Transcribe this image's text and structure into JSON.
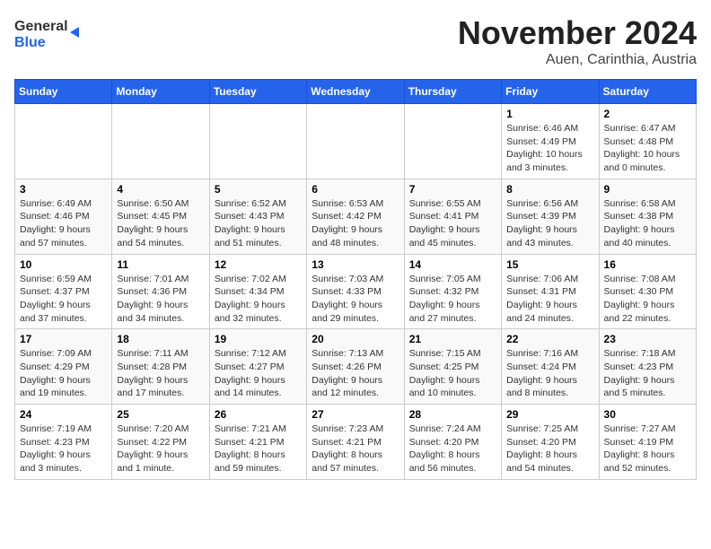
{
  "header": {
    "logo_line1": "General",
    "logo_line2": "Blue",
    "month_title": "November 2024",
    "location": "Auen, Carinthia, Austria"
  },
  "days_of_week": [
    "Sunday",
    "Monday",
    "Tuesday",
    "Wednesday",
    "Thursday",
    "Friday",
    "Saturday"
  ],
  "weeks": [
    [
      {
        "day": "",
        "info": ""
      },
      {
        "day": "",
        "info": ""
      },
      {
        "day": "",
        "info": ""
      },
      {
        "day": "",
        "info": ""
      },
      {
        "day": "",
        "info": ""
      },
      {
        "day": "1",
        "info": "Sunrise: 6:46 AM\nSunset: 4:49 PM\nDaylight: 10 hours and 3 minutes."
      },
      {
        "day": "2",
        "info": "Sunrise: 6:47 AM\nSunset: 4:48 PM\nDaylight: 10 hours and 0 minutes."
      }
    ],
    [
      {
        "day": "3",
        "info": "Sunrise: 6:49 AM\nSunset: 4:46 PM\nDaylight: 9 hours and 57 minutes."
      },
      {
        "day": "4",
        "info": "Sunrise: 6:50 AM\nSunset: 4:45 PM\nDaylight: 9 hours and 54 minutes."
      },
      {
        "day": "5",
        "info": "Sunrise: 6:52 AM\nSunset: 4:43 PM\nDaylight: 9 hours and 51 minutes."
      },
      {
        "day": "6",
        "info": "Sunrise: 6:53 AM\nSunset: 4:42 PM\nDaylight: 9 hours and 48 minutes."
      },
      {
        "day": "7",
        "info": "Sunrise: 6:55 AM\nSunset: 4:41 PM\nDaylight: 9 hours and 45 minutes."
      },
      {
        "day": "8",
        "info": "Sunrise: 6:56 AM\nSunset: 4:39 PM\nDaylight: 9 hours and 43 minutes."
      },
      {
        "day": "9",
        "info": "Sunrise: 6:58 AM\nSunset: 4:38 PM\nDaylight: 9 hours and 40 minutes."
      }
    ],
    [
      {
        "day": "10",
        "info": "Sunrise: 6:59 AM\nSunset: 4:37 PM\nDaylight: 9 hours and 37 minutes."
      },
      {
        "day": "11",
        "info": "Sunrise: 7:01 AM\nSunset: 4:36 PM\nDaylight: 9 hours and 34 minutes."
      },
      {
        "day": "12",
        "info": "Sunrise: 7:02 AM\nSunset: 4:34 PM\nDaylight: 9 hours and 32 minutes."
      },
      {
        "day": "13",
        "info": "Sunrise: 7:03 AM\nSunset: 4:33 PM\nDaylight: 9 hours and 29 minutes."
      },
      {
        "day": "14",
        "info": "Sunrise: 7:05 AM\nSunset: 4:32 PM\nDaylight: 9 hours and 27 minutes."
      },
      {
        "day": "15",
        "info": "Sunrise: 7:06 AM\nSunset: 4:31 PM\nDaylight: 9 hours and 24 minutes."
      },
      {
        "day": "16",
        "info": "Sunrise: 7:08 AM\nSunset: 4:30 PM\nDaylight: 9 hours and 22 minutes."
      }
    ],
    [
      {
        "day": "17",
        "info": "Sunrise: 7:09 AM\nSunset: 4:29 PM\nDaylight: 9 hours and 19 minutes."
      },
      {
        "day": "18",
        "info": "Sunrise: 7:11 AM\nSunset: 4:28 PM\nDaylight: 9 hours and 17 minutes."
      },
      {
        "day": "19",
        "info": "Sunrise: 7:12 AM\nSunset: 4:27 PM\nDaylight: 9 hours and 14 minutes."
      },
      {
        "day": "20",
        "info": "Sunrise: 7:13 AM\nSunset: 4:26 PM\nDaylight: 9 hours and 12 minutes."
      },
      {
        "day": "21",
        "info": "Sunrise: 7:15 AM\nSunset: 4:25 PM\nDaylight: 9 hours and 10 minutes."
      },
      {
        "day": "22",
        "info": "Sunrise: 7:16 AM\nSunset: 4:24 PM\nDaylight: 9 hours and 8 minutes."
      },
      {
        "day": "23",
        "info": "Sunrise: 7:18 AM\nSunset: 4:23 PM\nDaylight: 9 hours and 5 minutes."
      }
    ],
    [
      {
        "day": "24",
        "info": "Sunrise: 7:19 AM\nSunset: 4:23 PM\nDaylight: 9 hours and 3 minutes."
      },
      {
        "day": "25",
        "info": "Sunrise: 7:20 AM\nSunset: 4:22 PM\nDaylight: 9 hours and 1 minute."
      },
      {
        "day": "26",
        "info": "Sunrise: 7:21 AM\nSunset: 4:21 PM\nDaylight: 8 hours and 59 minutes."
      },
      {
        "day": "27",
        "info": "Sunrise: 7:23 AM\nSunset: 4:21 PM\nDaylight: 8 hours and 57 minutes."
      },
      {
        "day": "28",
        "info": "Sunrise: 7:24 AM\nSunset: 4:20 PM\nDaylight: 8 hours and 56 minutes."
      },
      {
        "day": "29",
        "info": "Sunrise: 7:25 AM\nSunset: 4:20 PM\nDaylight: 8 hours and 54 minutes."
      },
      {
        "day": "30",
        "info": "Sunrise: 7:27 AM\nSunset: 4:19 PM\nDaylight: 8 hours and 52 minutes."
      }
    ]
  ]
}
